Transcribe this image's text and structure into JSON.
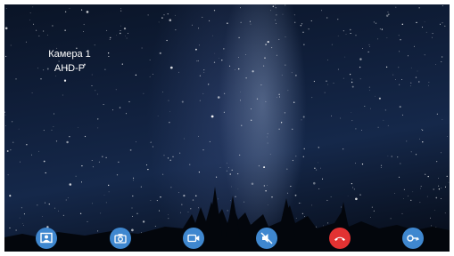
{
  "camera": {
    "name": "Камера 1",
    "format": "AHD-P"
  },
  "controls": [
    {
      "name": "view-cameras-button",
      "icon": "portrait-frame-icon",
      "color": "#3f87cf"
    },
    {
      "name": "snapshot-button",
      "icon": "camera-icon",
      "color": "#3f87cf"
    },
    {
      "name": "record-video-button",
      "icon": "video-camera-icon",
      "color": "#3f87cf"
    },
    {
      "name": "mute-button",
      "icon": "speaker-muted-icon",
      "color": "#3f87cf"
    },
    {
      "name": "hang-up-button",
      "icon": "phone-hangup-icon",
      "color": "#e23232"
    },
    {
      "name": "unlock-door-button",
      "icon": "key-icon",
      "color": "#3f87cf"
    }
  ]
}
